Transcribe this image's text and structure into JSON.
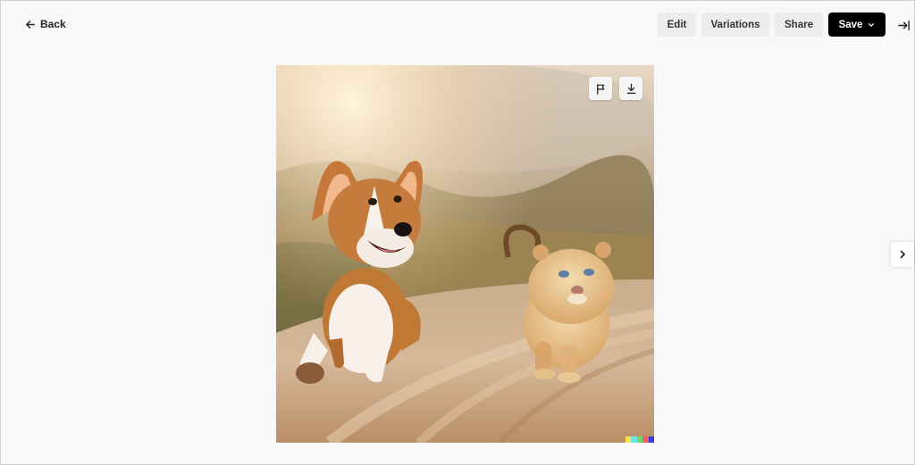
{
  "nav": {
    "back_label": "Back",
    "back_icon": "arrow-left-icon"
  },
  "toolbar": {
    "edit_label": "Edit",
    "variations_label": "Variations",
    "share_label": "Share",
    "save_label": "Save",
    "save_icon": "chevron-down-icon",
    "collapse_icon": "collapse-panel-icon"
  },
  "image": {
    "alt": "Corgi puppy and lion cub walking on a sunlit dirt road",
    "actions": [
      {
        "name": "report",
        "icon": "flag-icon"
      },
      {
        "name": "download",
        "icon": "download-icon"
      }
    ],
    "signature_colors": [
      "#f5e64a",
      "#6ee4e4",
      "#6ed46e",
      "#f06262",
      "#3a3ed8"
    ]
  },
  "pager": {
    "next_icon": "chevron-right-icon"
  },
  "colors": {
    "page_bg": "#f8f8fb",
    "button_bg": "#ececef",
    "primary_bg": "#000000",
    "primary_text": "#ffffff"
  }
}
